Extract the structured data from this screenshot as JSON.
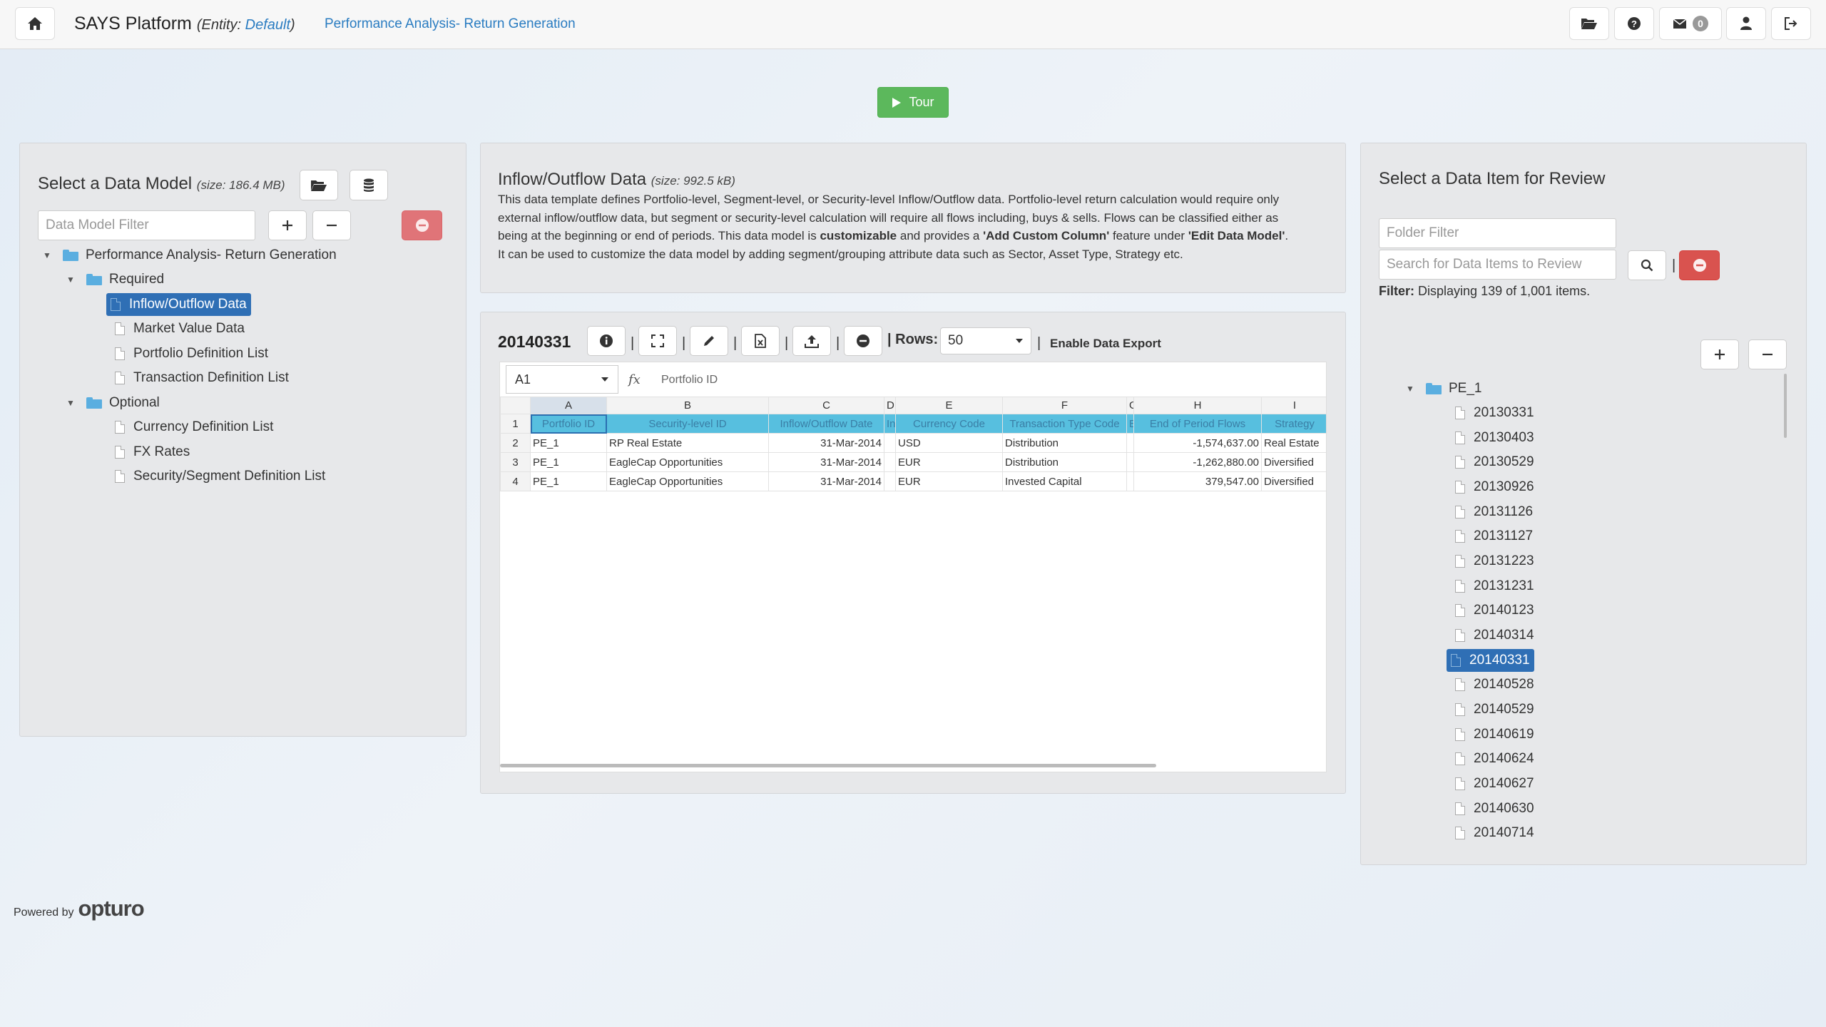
{
  "navbar": {
    "brand": "SAYS Platform",
    "entity_prefix": "(Entity:",
    "entity_name": "Default",
    "entity_suffix": ")",
    "breadcrumb": "Performance Analysis- Return Generation",
    "message_count": "0",
    "icons": [
      "home-icon",
      "folder-open-icon",
      "question-circle-icon",
      "envelope-icon",
      "user-icon",
      "sign-out-icon"
    ]
  },
  "tour": {
    "label": "Tour"
  },
  "left_panel": {
    "title": "Select a Data Model",
    "size": "(size: 186.4 MB)",
    "filter_placeholder": "Data Model Filter",
    "tree": {
      "root": "Performance Analysis- Return Generation",
      "required": {
        "label": "Required",
        "items": [
          "Inflow/Outflow Data",
          "Market Value Data",
          "Portfolio Definition List",
          "Transaction Definition List"
        ]
      },
      "optional": {
        "label": "Optional",
        "items": [
          "Currency Definition List",
          "FX Rates",
          "Security/Segment Definition List"
        ]
      }
    }
  },
  "description": {
    "title": "Inflow/Outflow Data",
    "size": "(size: 992.5 kB)",
    "text_1": "This data template defines Portfolio-level, Segment-level, or Security-level Inflow/Outflow data. Portfolio-level return calculation would require only external inflow/outflow data, but segment or security-level calculation will require all flows including, buys & sells. Flows can be classified either as being at the beginning or end of periods. This data model is ",
    "bold_1": "customizable",
    "text_2": " and provides a ",
    "bold_2": "'Add Custom Column'",
    "text_3": " feature under ",
    "bold_3": "'Edit Data Model'",
    "text_4": ". It can be used to customize the data model by adding segment/grouping attribute data such as Sector, Asset Type, Strategy etc."
  },
  "grid_panel": {
    "title": "20140331",
    "separator": "|",
    "rows_label": "| Rows:",
    "rows_value": "50",
    "export_label": "Enable Data Export",
    "cell_ref": "A1",
    "fx": "fx",
    "formula": "Portfolio ID",
    "columns": [
      "A",
      "B",
      "C",
      "D",
      "E",
      "F",
      "G",
      "H",
      "I"
    ],
    "header_row": [
      "Portfolio ID",
      "Security-level ID",
      "Inflow/Outflow Date",
      "In",
      "Currency Code",
      "Transaction Type Code",
      "E",
      "End of Period Flows",
      "Strategy"
    ],
    "rows": [
      [
        "PE_1",
        "RP Real Estate",
        "31-Mar-2014",
        "",
        "USD",
        "Distribution",
        "",
        "-1,574,637.00",
        "Real Estate"
      ],
      [
        "PE_1",
        "EagleCap Opportunities",
        "31-Mar-2014",
        "",
        "EUR",
        "Distribution",
        "",
        "-1,262,880.00",
        "Diversified"
      ],
      [
        "PE_1",
        "EagleCap Opportunities",
        "31-Mar-2014",
        "",
        "EUR",
        "Invested Capital",
        "",
        "379,547.00",
        "Diversified"
      ]
    ],
    "row_numbers": [
      "1",
      "2",
      "3",
      "4"
    ]
  },
  "right_panel": {
    "title": "Select a Data Item for Review",
    "folder_filter_placeholder": "Folder Filter",
    "search_placeholder": "Search for Data Items to Review",
    "separator": "|",
    "filter_label": "Filter:",
    "filter_text": "Displaying 139 of 1,001 items.",
    "tree_root": "PE_1",
    "items": [
      "20130331",
      "20130403",
      "20130529",
      "20130926",
      "20131126",
      "20131127",
      "20131223",
      "20131231",
      "20140123",
      "20140314",
      "20140331",
      "20140528",
      "20140529",
      "20140619",
      "20140624",
      "20140627",
      "20140630",
      "20140714"
    ],
    "selected": "20140331"
  },
  "footer": {
    "powered_by": "Powered by",
    "logo": "opturo"
  }
}
